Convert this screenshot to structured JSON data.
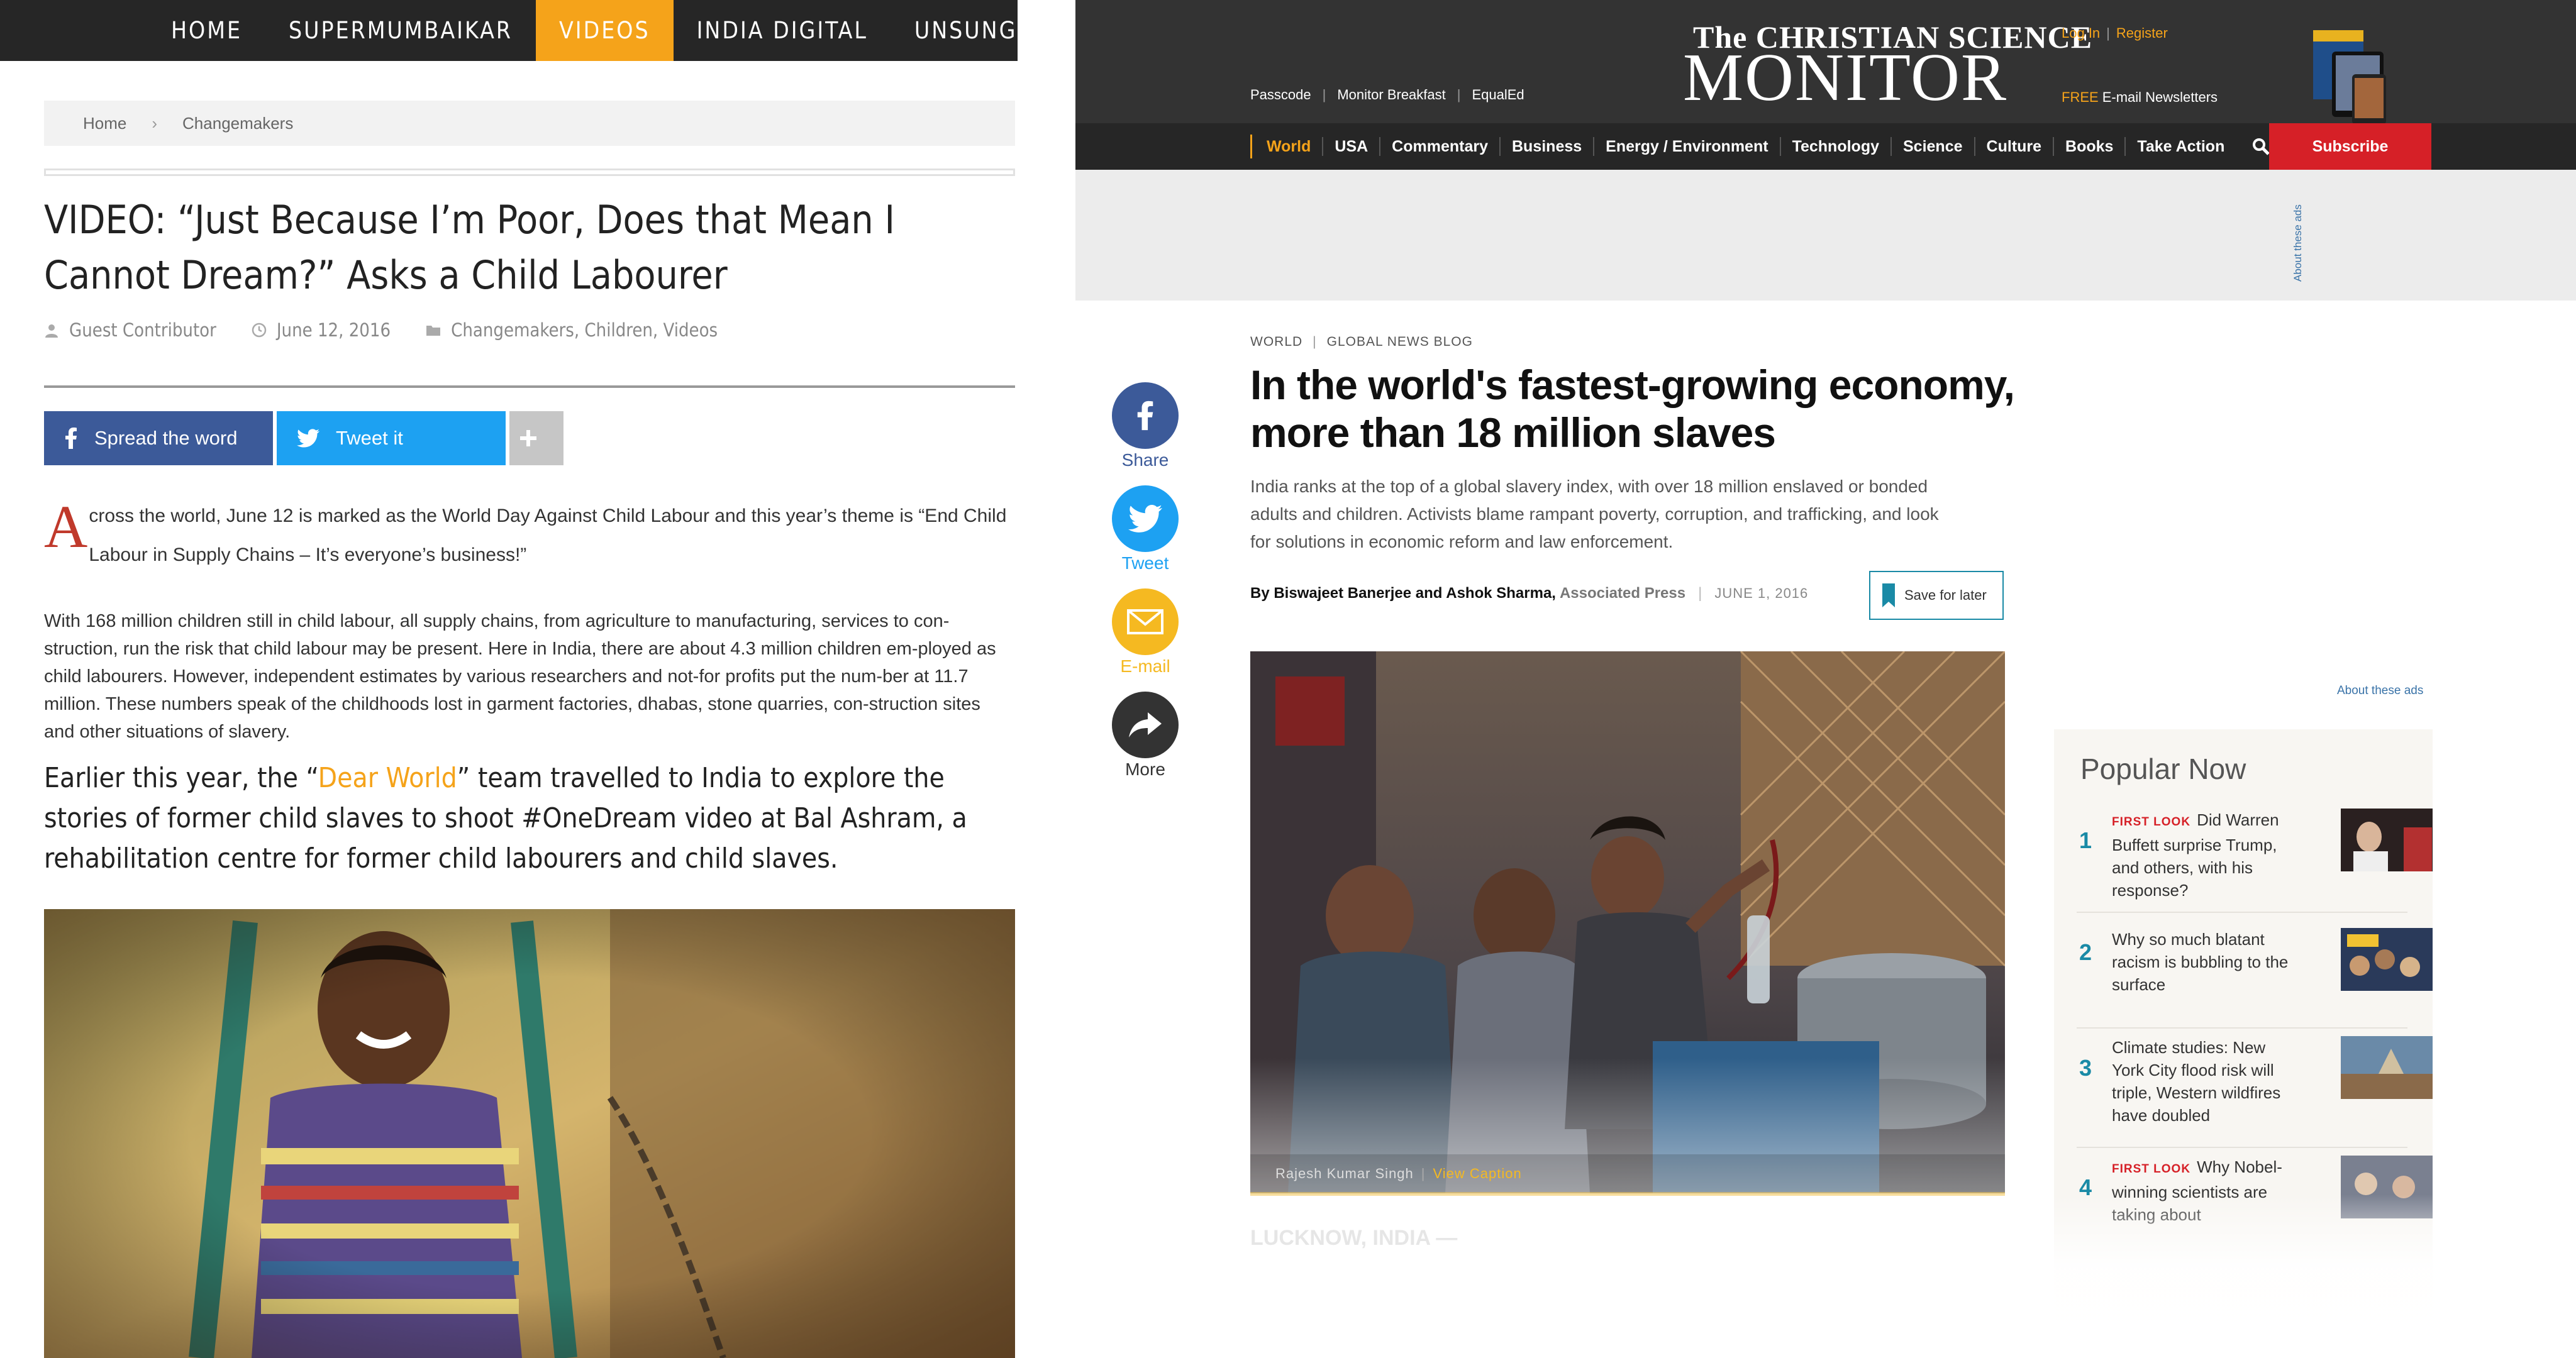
{
  "left": {
    "nav": [
      "HOME",
      "SUPERMUMBAIKAR",
      "VIDEOS",
      "INDIA DIGITAL",
      "UNSUNG HEROES"
    ],
    "nav_active_index": 2,
    "breadcrumb": {
      "home": "Home",
      "current": "Changemakers"
    },
    "title": "VIDEO: “Just Because I’m Poor, Does that Mean I Cannot Dream?” Asks a Child Labourer",
    "meta": {
      "author": "Guest Contributor",
      "date": "June 12, 2016",
      "categories": "Changemakers, Children, Videos"
    },
    "share": {
      "facebook": "Spread the word",
      "twitter": "Tweet it",
      "more": "+"
    },
    "para1_dropcap": "A",
    "para1_rest": "cross the world, June 12 is marked as the World Day Against Child Labour and this year’s theme is “End Child Labour in Supply Chains – It’s everyone’s business!”",
    "para2": "With 168 million children still in child labour, all supply chains, from agriculture to manufacturing, services to con-struction, run the risk that child labour may be present. Here in India, there are about 4.3 million children em-ployed as child labourers. However, independent estimates by various researchers and not-for profits put the num-ber at 11.7 million. These numbers speak of the childhoods lost in garment factories, dhabas, stone quarries, con-struction sites and other situations of slavery.",
    "para3_a": "Earlier this year, the “",
    "para3_link": "Dear World",
    "para3_b": "” team travelled to India to explore the stories of former child slaves to shoot #OneDream video at Bal Ashram, a rehabilitation centre for former child labourers and child slaves.",
    "colors": {
      "accent": "#f5a31a",
      "facebook": "#3c5a99",
      "twitter": "#1da1f2",
      "nav_bg": "#262626"
    }
  },
  "right": {
    "header": {
      "logo_small": "The CHRISTIAN SCIENCE",
      "logo_big": "MONITOR",
      "links": [
        "Passcode",
        "Monitor Breakfast",
        "EqualEd"
      ],
      "login": "Log In",
      "register": "Register",
      "newsletter_free": "FREE",
      "newsletter": "E-mail Newsletters"
    },
    "nav": [
      "World",
      "USA",
      "Commentary",
      "Business",
      "Energy / Environment",
      "Technology",
      "Science",
      "Culture",
      "Books",
      "Take Action"
    ],
    "subscribe": "Subscribe",
    "about_ads": "About these ads",
    "kicker": {
      "section": "WORLD",
      "blog": "GLOBAL NEWS BLOG"
    },
    "title": "In the world's fastest-growing economy, more than 18 million slaves",
    "summary": "India ranks at the top of a global slavery index, with over 18 million enslaved or bonded adults and children. Activists blame rampant poverty, corruption, and trafficking, and look for solutions in economic reform and law enforcement.",
    "byline": {
      "by": "By Biswajeet Banerjee and Ashok Sharma,",
      "org": "Associated Press",
      "date": "JUNE 1, 2016"
    },
    "save": "Save for later",
    "share": [
      {
        "label": "Share",
        "icon": "facebook-icon",
        "color": "#3c5a99"
      },
      {
        "label": "Tweet",
        "icon": "twitter-icon",
        "color": "#1da1f2"
      },
      {
        "label": "E-mail",
        "icon": "mail-icon",
        "color": "#f5b921"
      },
      {
        "label": "More",
        "icon": "share-arrow-icon",
        "color": "#333333"
      }
    ],
    "photo_caption": {
      "credit": "Rajesh Kumar Singh",
      "view": "View Caption"
    },
    "faded_lede": "LUCKNOW, INDIA —",
    "popular": {
      "title": "Popular Now",
      "items": [
        {
          "num": "1",
          "flag": "FIRST LOOK",
          "text": "Did Warren Buffett surprise Trump, and others, with his response?"
        },
        {
          "num": "2",
          "flag": "",
          "text": "Why so much blatant racism is bubbling to the surface"
        },
        {
          "num": "3",
          "flag": "",
          "text": "Climate studies: New York City flood risk will triple, Western wildfires have doubled"
        },
        {
          "num": "4",
          "flag": "FIRST LOOK",
          "text": "Why Nobel-winning scientists are taking about"
        }
      ]
    },
    "colors": {
      "accent": "#f5a31a",
      "subscribe": "#d62027",
      "teal": "#1a8aa6"
    }
  }
}
